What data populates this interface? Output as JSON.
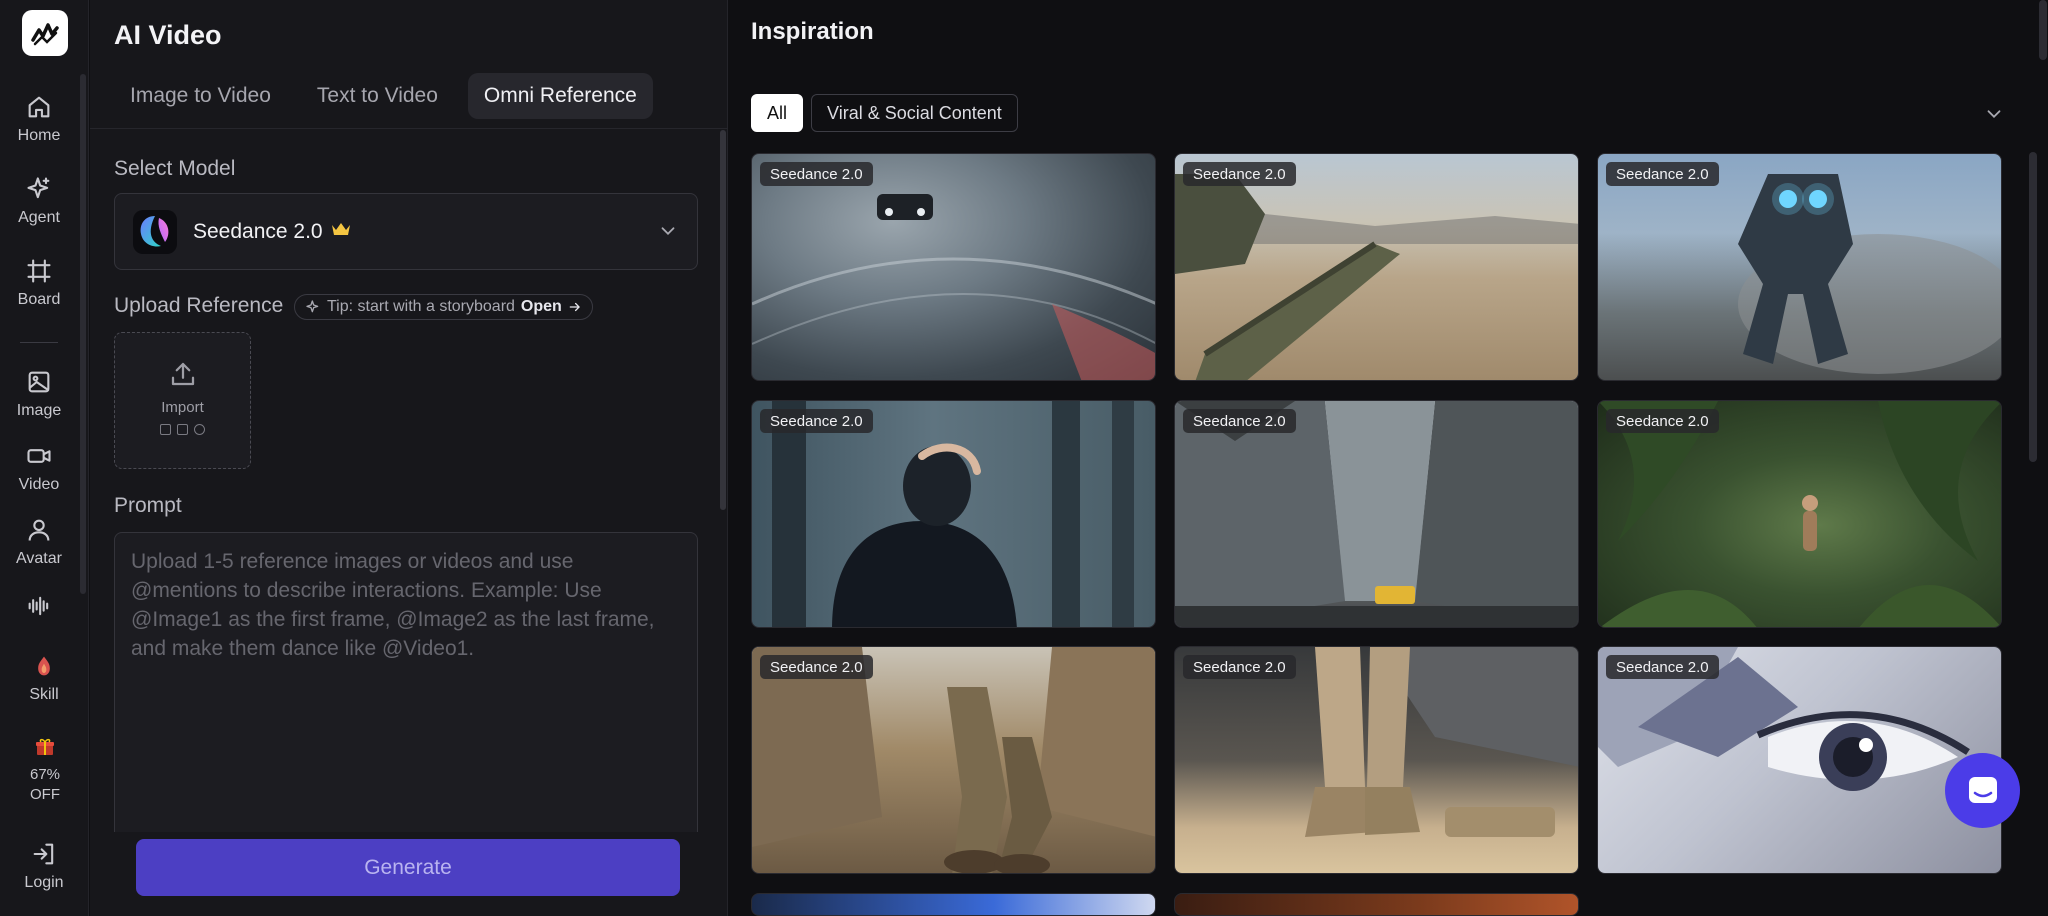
{
  "rail": {
    "items": [
      {
        "label": "Home",
        "icon": "home-icon"
      },
      {
        "label": "Agent",
        "icon": "sparkle-icon"
      },
      {
        "label": "Board",
        "icon": "board-icon"
      },
      {
        "label": "Image",
        "icon": "image-icon"
      },
      {
        "label": "Video",
        "icon": "video-icon"
      },
      {
        "label": "Avatar",
        "icon": "avatar-icon"
      },
      {
        "label": "Skill",
        "icon": "skill-icon"
      },
      {
        "label": "Login",
        "icon": "login-icon"
      }
    ],
    "promo": {
      "line1": "67%",
      "line2": "OFF"
    }
  },
  "panel": {
    "title": "AI Video",
    "tabs": [
      "Image to Video",
      "Text to Video",
      "Omni Reference"
    ],
    "active_tab": "Omni Reference",
    "select_model_label": "Select Model",
    "model_name": "Seedance 2.0",
    "upload_label": "Upload Reference",
    "tip_text": "Tip: start with a storyboard",
    "tip_link": "Open",
    "import_label": "Import",
    "prompt_label": "Prompt",
    "prompt_placeholder": "Upload 1-5 reference images or videos and use @mentions to describe interactions. Example: Use @Image1 as the first frame, @Image2 as the last frame, and make them dance like @Video1.",
    "generate_label": "Generate"
  },
  "inspiration": {
    "title": "Inspiration",
    "chips": [
      "All",
      "Viral & Social Content"
    ],
    "active_chip": "All",
    "cards": [
      {
        "badge": "Seedance 2.0",
        "scene": "race car on wet track"
      },
      {
        "badge": "Seedance 2.0",
        "scene": "tank in desert"
      },
      {
        "badge": "Seedance 2.0",
        "scene": "mech robot in smoke"
      },
      {
        "badge": "Seedance 2.0",
        "scene": "person in dark forest"
      },
      {
        "badge": "Seedance 2.0",
        "scene": "city street with skyscrapers"
      },
      {
        "badge": "Seedance 2.0",
        "scene": "jungle explorers"
      },
      {
        "badge": "Seedance 2.0",
        "scene": "soldiers walking in ruins"
      },
      {
        "badge": "Seedance 2.0",
        "scene": "soldier boots in hangar"
      },
      {
        "badge": "Seedance 2.0",
        "scene": "anime eye close-up"
      }
    ]
  },
  "colors": {
    "accent": "#4c3fc3",
    "fab": "#4b3ce8",
    "crown": "#f4c542"
  }
}
